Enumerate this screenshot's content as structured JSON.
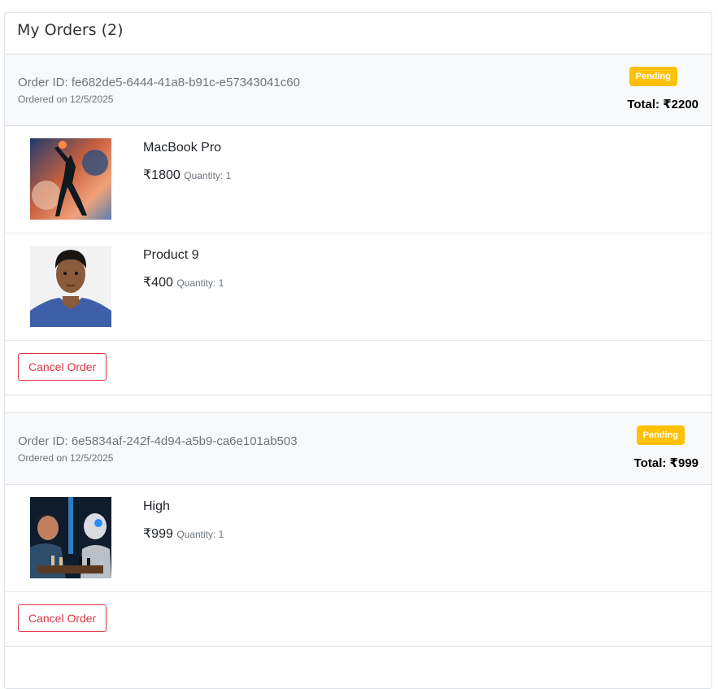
{
  "page": {
    "title": "My Orders (2)"
  },
  "orders": [
    {
      "order_id": "Order ID: fe682de5-6444-41a8-b91c-e57343041c60",
      "ordered_on": "Ordered on 12/5/2025",
      "status": "Pending",
      "total": "Total: ₹2200",
      "items": [
        {
          "name": "MacBook Pro",
          "price": "₹1800",
          "quantity": "Quantity: 1",
          "image": "basketball-dunk-art"
        },
        {
          "name": "Product 9",
          "price": "₹400",
          "quantity": "Quantity: 1",
          "image": "portrait-photo"
        }
      ],
      "cancel_label": "Cancel Order"
    },
    {
      "order_id": "Order ID: 6e5834af-242f-4d94-a5b9-ca6e101ab503",
      "ordered_on": "Ordered on 12/5/2025",
      "status": "Pending",
      "total": "Total: ₹999",
      "items": [
        {
          "name": "High",
          "price": "₹999",
          "quantity": "Quantity: 1",
          "image": "human-vs-robot-chess"
        }
      ],
      "cancel_label": "Cancel Order"
    }
  ],
  "colors": {
    "status_pending": "#ffc107",
    "cancel": "#dc3545",
    "header_bg": "#f8f9fa",
    "muted": "#6c757d"
  }
}
